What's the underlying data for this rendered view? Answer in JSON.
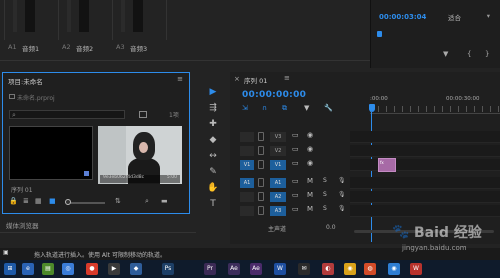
{
  "mixer": {
    "channels": [
      {
        "id": "A1",
        "name": "音频1"
      },
      {
        "id": "A2",
        "name": "音频2"
      },
      {
        "id": "A3",
        "name": "音频3"
      }
    ]
  },
  "program": {
    "timecode": "00:00:03:04",
    "fit_label": "适合",
    "caret": "▾",
    "ctrl_marker": "▼",
    "ctrl_in": "{",
    "ctrl_out": "}"
  },
  "project": {
    "title": "项目:未命名",
    "menu": "≡",
    "file": "未命名.prproj",
    "search_placeholder": "",
    "search_glyph": "⌕",
    "item_count": "1项",
    "thumb1_label": "序列 01",
    "thumb2_caption": "9e3eb062f4d3d8c",
    "thumb2_duration": "5:00",
    "toolbar": {
      "lock": "🔒",
      "list": "≣",
      "icon": "▦",
      "freeform": "■",
      "sort": "⇅",
      "search": "⌕",
      "bin": "▬"
    }
  },
  "media_browser": {
    "label": "媒体浏览器"
  },
  "tools": [
    {
      "name": "selection-tool",
      "glyph": "▶",
      "active": true
    },
    {
      "name": "track-select-tool",
      "glyph": "⇶"
    },
    {
      "name": "ripple-edit-tool",
      "glyph": "✚"
    },
    {
      "name": "razor-tool",
      "glyph": "◆"
    },
    {
      "name": "slip-tool",
      "glyph": "↔"
    },
    {
      "name": "pen-tool",
      "glyph": "✎"
    },
    {
      "name": "hand-tool",
      "glyph": "✋"
    },
    {
      "name": "type-tool",
      "glyph": "T"
    }
  ],
  "timeline": {
    "close": "×",
    "tab": "序列 01",
    "menu": "≡",
    "timecode": "00:00:00:00",
    "ruler_start": ":00:00",
    "ruler_mark": "00:00:30:00",
    "tools": {
      "snap": "∩",
      "link": "⧉",
      "marker": "▼",
      "wrench": "🔧"
    },
    "video_tracks": [
      {
        "label": "V3",
        "src": ""
      },
      {
        "label": "V2",
        "src": ""
      },
      {
        "label": "V1",
        "src": "V1"
      }
    ],
    "audio_tracks": [
      {
        "label": "A1",
        "src": "A1"
      },
      {
        "label": "A2",
        "src": ""
      },
      {
        "label": "A3",
        "src": ""
      }
    ],
    "track_icons": {
      "film": "▭",
      "eye": "◉",
      "mute": "M",
      "solo": "S",
      "mic": "🎙"
    },
    "clip_label": "fx",
    "master_label": "主声道",
    "master_value": "0.0"
  },
  "status": {
    "text": "拖入轨道进行插入。使用 Alt 可限制移动的轨道。",
    "icon": "▣"
  },
  "taskbar": {
    "items": [
      {
        "glyph": "⊞",
        "color": "#1e5aa8"
      },
      {
        "glyph": "e",
        "color": "#2a63b5"
      },
      {
        "glyph": "▤",
        "color": "#4d8a2a"
      },
      {
        "glyph": "◎",
        "color": "#3b7dd8"
      },
      {
        "glyph": "●",
        "color": "#d83b2b"
      },
      {
        "glyph": "▶",
        "color": "#3a3a3a"
      },
      {
        "glyph": "◆",
        "color": "#2f5d99"
      },
      {
        "glyph": "Ps",
        "color": "#1d3f66"
      },
      {
        "glyph": "Pr",
        "color": "#3b2a55"
      },
      {
        "glyph": "Ae",
        "color": "#3c2d5b"
      },
      {
        "glyph": "Ae",
        "color": "#4b2b6a"
      },
      {
        "glyph": "W",
        "color": "#1e4fa0"
      },
      {
        "glyph": "✉",
        "color": "#2a2a2a"
      }
    ],
    "tray": [
      {
        "glyph": "◐",
        "color": "#b23c3c"
      },
      {
        "glyph": "◉",
        "color": "#d9a21a"
      },
      {
        "glyph": "◍",
        "color": "#d24b28"
      },
      {
        "glyph": "◉",
        "color": "#2e7ed3"
      },
      {
        "glyph": "W",
        "color": "#b8332d"
      }
    ]
  },
  "watermark": {
    "brand": "Baid 经验",
    "url": "jingyan.baidu.com"
  }
}
